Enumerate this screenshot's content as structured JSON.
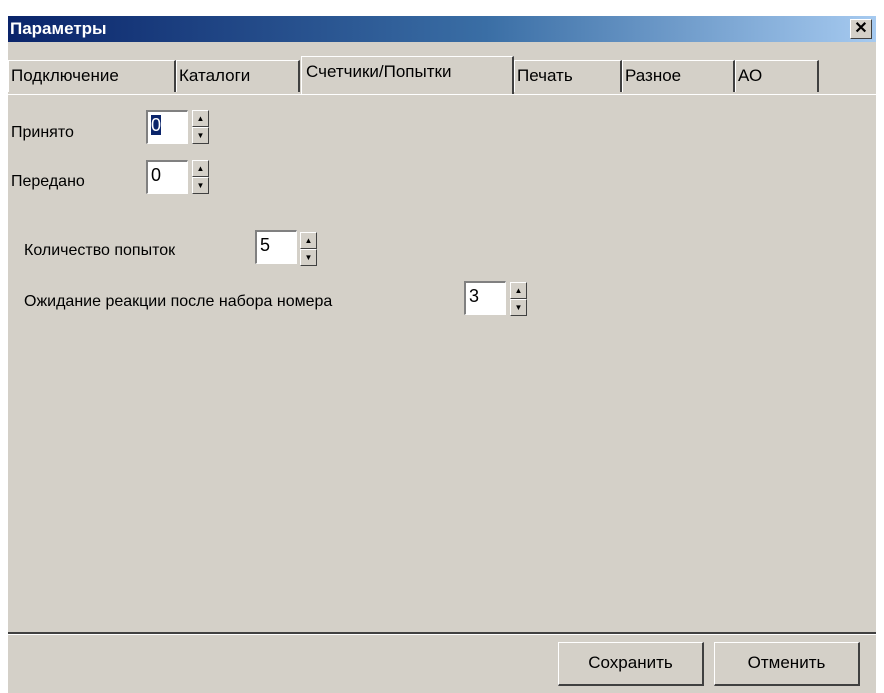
{
  "window": {
    "title": "Параметры",
    "close_glyph": "✕"
  },
  "tabs": [
    {
      "label": "Подключение",
      "active": false
    },
    {
      "label": "Каталоги",
      "active": false
    },
    {
      "label": "Счетчики/Попытки",
      "active": true
    },
    {
      "label": "Печать",
      "active": false
    },
    {
      "label": "Разное",
      "active": false
    },
    {
      "label": "АО",
      "active": false
    }
  ],
  "counters": {
    "received": {
      "label": "Принято",
      "value": "0",
      "selected": true
    },
    "sent": {
      "label": "Передано",
      "value": "0",
      "selected": false
    }
  },
  "attempts": {
    "count": {
      "label": "Количество попыток",
      "value": "5"
    },
    "wait": {
      "label": "Ожидание реакции после набора номера",
      "value": "3"
    }
  },
  "spin_glyphs": {
    "up": "▲",
    "down": "▼"
  },
  "buttons": {
    "save": "Сохранить",
    "cancel": "Отменить"
  },
  "colors": {
    "face": "#d4d0c8",
    "title_start": "#0a246a",
    "title_end": "#a6caf0",
    "selection": "#0a246a"
  }
}
